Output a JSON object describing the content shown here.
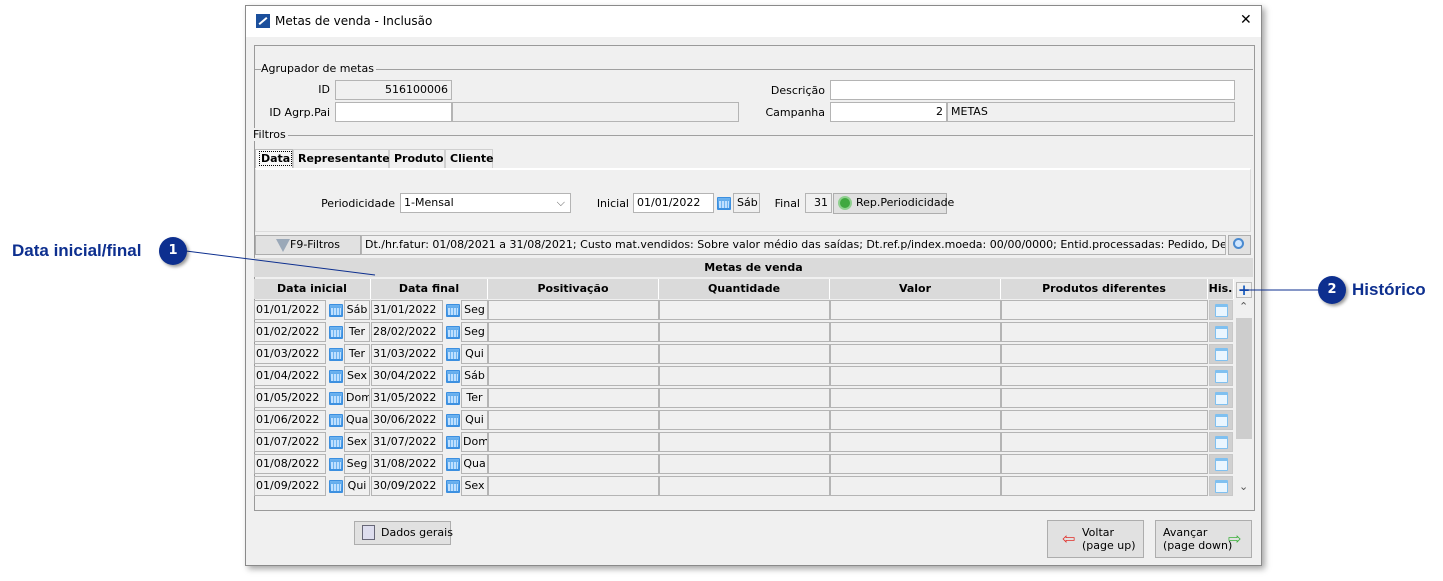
{
  "window": {
    "title": "Metas de venda - Inclusão",
    "close": "✕"
  },
  "agrupador": {
    "legend": "Agrupador de metas",
    "id_label": "ID",
    "id_value": "516100006",
    "pai_label": "ID Agrp.Pai",
    "pai_value": "",
    "pai_desc": "",
    "descricao_label": "Descrição",
    "descricao_value": "",
    "campanha_label": "Campanha",
    "campanha_value": "2",
    "campanha_desc": "METAS"
  },
  "filtros": {
    "legend": "Filtros",
    "tabs": [
      "Data",
      "Representante",
      "Produto",
      "Cliente"
    ],
    "active_tab": "Data",
    "periodicidade_label": "Periodicidade",
    "periodicidade_value": "1-Mensal",
    "inicial_label": "Inicial",
    "inicial_value": "01/01/2022",
    "inicial_day": "Sáb",
    "final_label": "Final",
    "final_value": "31",
    "rep_button": "Rep.Periodicidade",
    "f9_button": "F9-Filtros",
    "summary": "Dt./hr.fatur: 01/08/2021 a 31/08/2021; Custo mat.vendidos: Sobre valor médio das saídas; Dt.ref.p/index.moeda: 00/00/0000; Entid.processadas: Pedido, Devolução,"
  },
  "grid": {
    "title": "Metas de venda",
    "columns": [
      "Data inicial",
      "Data final",
      "Positivação",
      "Quantidade",
      "Valor",
      "Produtos diferentes",
      "His."
    ],
    "add_button": "+",
    "rows": [
      {
        "ini": "01/01/2022",
        "ini_day": "Sáb",
        "fim": "31/01/2022",
        "fim_day": "Seg"
      },
      {
        "ini": "01/02/2022",
        "ini_day": "Ter",
        "fim": "28/02/2022",
        "fim_day": "Seg"
      },
      {
        "ini": "01/03/2022",
        "ini_day": "Ter",
        "fim": "31/03/2022",
        "fim_day": "Qui"
      },
      {
        "ini": "01/04/2022",
        "ini_day": "Sex",
        "fim": "30/04/2022",
        "fim_day": "Sáb"
      },
      {
        "ini": "01/05/2022",
        "ini_day": "Dom",
        "fim": "31/05/2022",
        "fim_day": "Ter"
      },
      {
        "ini": "01/06/2022",
        "ini_day": "Qua",
        "fim": "30/06/2022",
        "fim_day": "Qui"
      },
      {
        "ini": "01/07/2022",
        "ini_day": "Sex",
        "fim": "31/07/2022",
        "fim_day": "Dom"
      },
      {
        "ini": "01/08/2022",
        "ini_day": "Seg",
        "fim": "31/08/2022",
        "fim_day": "Qua"
      },
      {
        "ini": "01/09/2022",
        "ini_day": "Qui",
        "fim": "30/09/2022",
        "fim_day": "Sex"
      }
    ]
  },
  "footer": {
    "dados_gerais": "Dados gerais",
    "voltar": "Voltar",
    "voltar_sub": "(page up)",
    "avancar": "Avançar",
    "avancar_sub": "(page down)"
  },
  "annotations": [
    {
      "num": "1",
      "text": "Data inicial/final"
    },
    {
      "num": "2",
      "text": "Histórico"
    }
  ],
  "colors": {
    "annotation": "#0d2f8f",
    "window_bg": "#f0f0f0",
    "header_bg": "#dadada"
  }
}
